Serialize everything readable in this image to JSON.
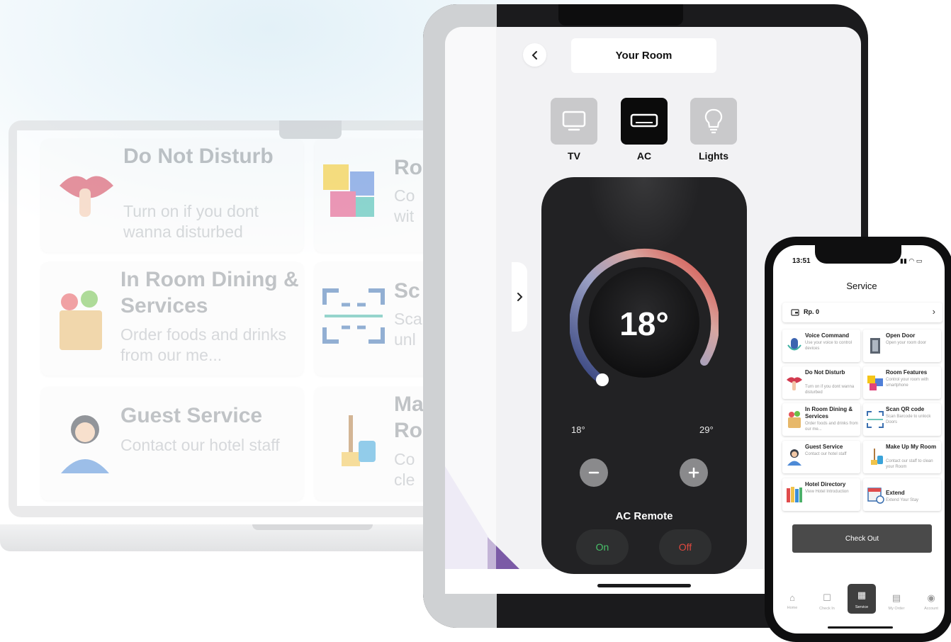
{
  "laptop": {
    "cards": [
      {
        "title": "Do Not Disturb",
        "desc": "Turn on if you dont wanna disturbed"
      },
      {
        "title": "Ro",
        "desc": "Co wit"
      },
      {
        "title": "In Room Dining & Services",
        "desc": "Order foods and drinks from our me..."
      },
      {
        "title": "Sc",
        "desc": "Sca unl"
      },
      {
        "title": "Guest Service",
        "desc": "Contact our hotel staff"
      },
      {
        "title": "Ma Ro",
        "desc": "Co cle"
      }
    ]
  },
  "tablet": {
    "header_title": "Your Room",
    "devices": [
      {
        "label": "TV",
        "icon": "tv-icon",
        "active": false
      },
      {
        "label": "AC",
        "icon": "ac-icon",
        "active": true
      },
      {
        "label": "Lights",
        "icon": "lightbulb-icon",
        "active": false
      }
    ],
    "remote": {
      "temperature": "18°",
      "min_label": "18°",
      "max_label": "29°",
      "title": "AC Remote",
      "on_label": "On",
      "off_label": "Off",
      "dial_level": 0.0
    },
    "colors": {
      "on": "#49c26a",
      "off": "#e2493f",
      "active_tab": "#0b0b0b",
      "inactive_tab": "#c9c9cb"
    }
  },
  "phone": {
    "time": "13:51",
    "title": "Service",
    "wallet": "Rp. 0",
    "services": [
      {
        "title": "Voice Command",
        "desc": "Use your voice to control devices",
        "icon": "microphone-icon"
      },
      {
        "title": "Open Door",
        "desc": "Open your room door",
        "icon": "door-icon"
      },
      {
        "title": "Do Not Disturb",
        "desc": "Turn on if you dont wanna disturbed",
        "icon": "lips-icon"
      },
      {
        "title": "Room Features",
        "desc": "Control your room with smartphone",
        "icon": "puzzle-icon"
      },
      {
        "title": "In Room Dining & Services",
        "desc": "Order foods and drinks from our me...",
        "icon": "grocery-bag-icon"
      },
      {
        "title": "Scan QR code",
        "desc": "Scan Barcode to unlock Doors",
        "icon": "qr-scan-icon"
      },
      {
        "title": "Guest Service",
        "desc": "Contact our hotel staff",
        "icon": "receptionist-icon"
      },
      {
        "title": "Make Up My Room",
        "desc": "Contact our staff to clean your Room",
        "icon": "cleaning-icon"
      },
      {
        "title": "Hotel Directory",
        "desc": "View Hotel Introduction",
        "icon": "books-icon"
      },
      {
        "title": "Extend",
        "desc": "Extend Your Stay",
        "icon": "calendar-icon"
      }
    ],
    "checkout_label": "Check Out",
    "tabs": [
      {
        "label": "Home",
        "icon": "home-icon"
      },
      {
        "label": "Check In",
        "icon": "checkin-icon"
      },
      {
        "label": "Service",
        "icon": "service-grid-icon",
        "active": true
      },
      {
        "label": "My Order",
        "icon": "order-icon"
      },
      {
        "label": "Account",
        "icon": "account-icon"
      }
    ]
  }
}
